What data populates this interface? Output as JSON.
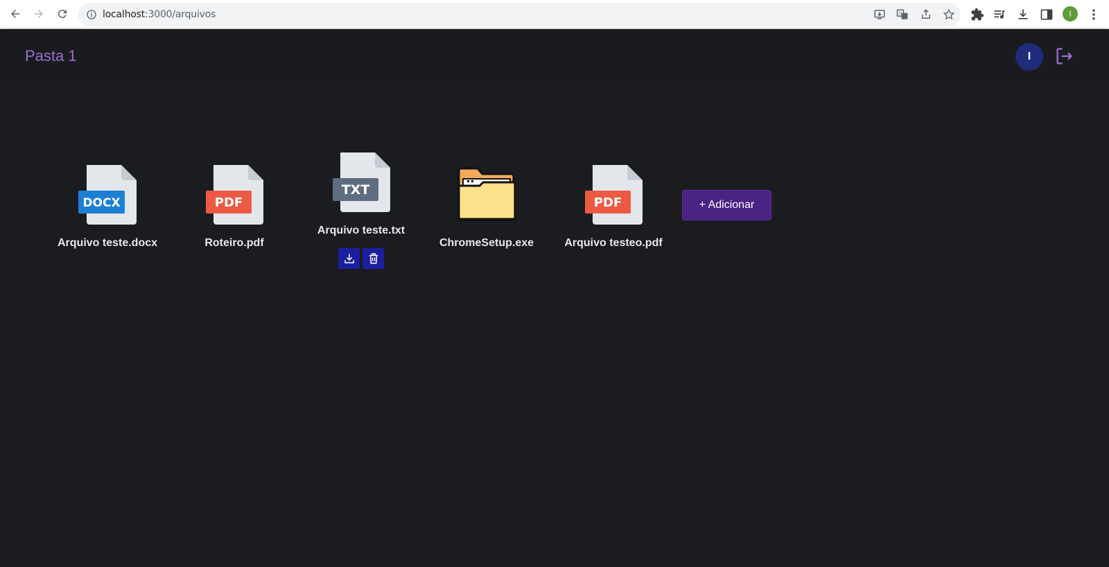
{
  "browser": {
    "url_host": "localhost",
    "url_path": ":3000/arquivos",
    "profile_initial": "I"
  },
  "header": {
    "folder_title": "Pasta 1",
    "avatar_initial": "I"
  },
  "files": [
    {
      "name": "Arquivo teste.docx",
      "badge": "DOCX",
      "badge_color": "#1d7fd3",
      "icon": "docx-file-icon"
    },
    {
      "name": "Roteiro.pdf",
      "badge": "PDF",
      "badge_color": "#ec5a44",
      "icon": "pdf-file-icon"
    },
    {
      "name": "Arquivo teste.txt",
      "badge": "TXT",
      "badge_color": "#5e6d7f",
      "icon": "txt-file-icon"
    },
    {
      "name": "ChromeSetup.exe",
      "badge": "",
      "icon": "folder-icon"
    },
    {
      "name": "Arquivo testeo.pdf",
      "badge": "PDF",
      "badge_color": "#ec5a44",
      "icon": "pdf-file-icon"
    }
  ],
  "add_button_label": "+ Adicionar",
  "colors": {
    "background": "#1b1c20",
    "accent": "#9b6fd6",
    "action_button": "#1b1f9e",
    "add_button": "#4a2383"
  }
}
